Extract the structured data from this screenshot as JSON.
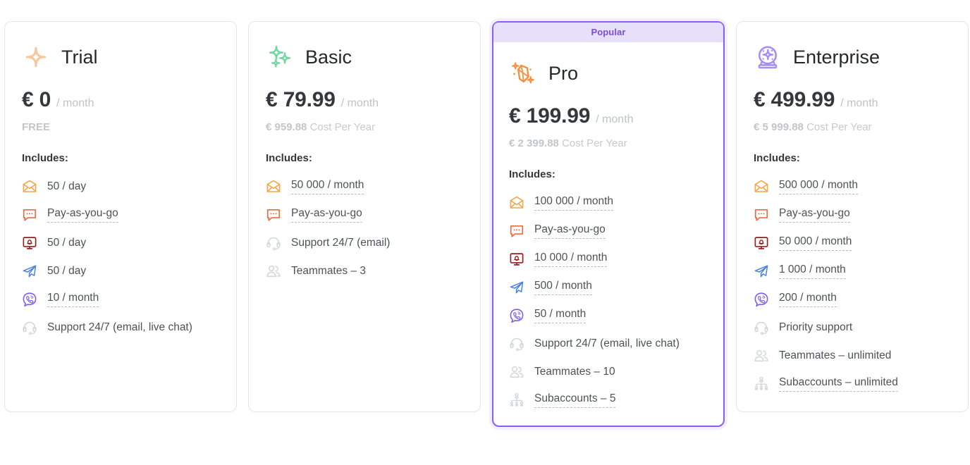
{
  "plans": [
    {
      "name": "Trial",
      "icon": "sparkle-single-icon",
      "badge": null,
      "price_amount": "€ 0",
      "price_period": "/ month",
      "sub_amount": "FREE",
      "sub_label": "",
      "includes_label": "Includes:",
      "features": [
        {
          "icon": "email-icon",
          "text": "50 / day",
          "dotted": false
        },
        {
          "icon": "sms-icon",
          "text": "Pay-as-you-go",
          "dotted": true
        },
        {
          "icon": "web-push-icon",
          "text": "50 / day",
          "dotted": false
        },
        {
          "icon": "telegram-icon",
          "text": "50 / day",
          "dotted": false
        },
        {
          "icon": "viber-icon",
          "text": "10 / month",
          "dotted": true
        },
        {
          "icon": "support-icon",
          "text": "Support 24/7 (email, live chat)",
          "dotted": false
        }
      ]
    },
    {
      "name": "Basic",
      "icon": "sparkle-triple-icon",
      "badge": null,
      "price_amount": "€ 79.99",
      "price_period": "/ month",
      "sub_amount": "€ 959.88",
      "sub_label": "Cost Per Year",
      "includes_label": "Includes:",
      "features": [
        {
          "icon": "email-icon",
          "text": "50 000 / month",
          "dotted": true
        },
        {
          "icon": "sms-icon",
          "text": "Pay-as-you-go",
          "dotted": true
        },
        {
          "icon": "support-icon",
          "text": "Support 24/7 (email)",
          "dotted": false
        },
        {
          "icon": "teammates-icon",
          "text": "Teammates – 3",
          "dotted": false
        }
      ]
    },
    {
      "name": "Pro",
      "icon": "gem-icon",
      "badge": "Popular",
      "price_amount": "€ 199.99",
      "price_period": "/ month",
      "sub_amount": "€ 2 399.88",
      "sub_label": "Cost Per Year",
      "includes_label": "Includes:",
      "features": [
        {
          "icon": "email-icon",
          "text": "100 000 / month",
          "dotted": true
        },
        {
          "icon": "sms-icon",
          "text": "Pay-as-you-go",
          "dotted": true
        },
        {
          "icon": "web-push-icon",
          "text": "10 000 / month",
          "dotted": true
        },
        {
          "icon": "telegram-icon",
          "text": "500 / month",
          "dotted": true
        },
        {
          "icon": "viber-icon",
          "text": "50 / month",
          "dotted": true
        },
        {
          "icon": "support-icon",
          "text": "Support 24/7 (email, live chat)",
          "dotted": false
        },
        {
          "icon": "teammates-icon",
          "text": "Teammates – 10",
          "dotted": false
        },
        {
          "icon": "subaccounts-icon",
          "text": "Subaccounts – 5",
          "dotted": true
        }
      ]
    },
    {
      "name": "Enterprise",
      "icon": "crystal-ball-icon",
      "badge": null,
      "price_amount": "€ 499.99",
      "price_period": "/ month",
      "sub_amount": "€ 5 999.88",
      "sub_label": "Cost Per Year",
      "includes_label": "Includes:",
      "features": [
        {
          "icon": "email-icon",
          "text": "500 000 / month",
          "dotted": true
        },
        {
          "icon": "sms-icon",
          "text": "Pay-as-you-go",
          "dotted": true
        },
        {
          "icon": "web-push-icon",
          "text": "50 000 / month",
          "dotted": true
        },
        {
          "icon": "telegram-icon",
          "text": "1 000 / month",
          "dotted": true
        },
        {
          "icon": "viber-icon",
          "text": "200 / month",
          "dotted": true
        },
        {
          "icon": "support-icon",
          "text": "Priority support",
          "dotted": false
        },
        {
          "icon": "teammates-icon",
          "text": "Teammates – unlimited",
          "dotted": false
        },
        {
          "icon": "subaccounts-icon",
          "text": "Subaccounts – unlimited",
          "dotted": true
        }
      ]
    }
  ],
  "colors": {
    "email": "#f5a545",
    "sms": "#f0673c",
    "web_push": "#9b1c1c",
    "telegram": "#4a7fe0",
    "viber": "#7c5cf0",
    "gray_icon": "#d3d6da",
    "trial_accent": "#f8c89a",
    "basic_accent": "#74d6a0",
    "pro_accent": "#f59040",
    "enterprise_accent": "#a78bfa",
    "featured_border": "#8b5cf6",
    "badge_bg": "#e7e0fb",
    "badge_text": "#7c4dd8"
  }
}
